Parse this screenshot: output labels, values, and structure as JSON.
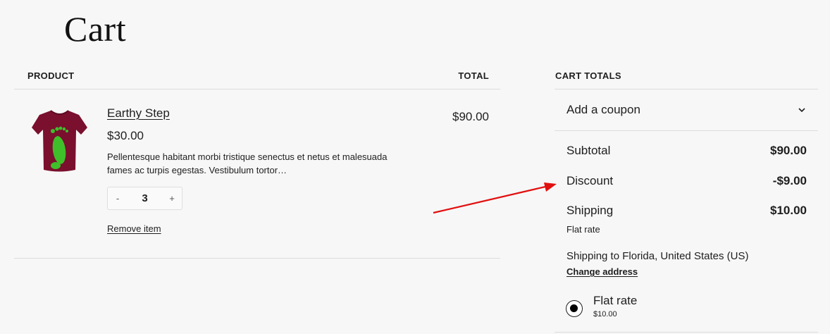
{
  "page": {
    "title": "Cart"
  },
  "table": {
    "product_header": "PRODUCT",
    "total_header": "TOTAL"
  },
  "item": {
    "name": "Earthy Step",
    "price": "$30.00",
    "description": "Pellentesque habitant morbi tristique senectus et netus et malesuada fames ac turpis egestas. Vestibulum tortor…",
    "quantity": "3",
    "decrease": "-",
    "increase": "+",
    "remove_label": "Remove item",
    "line_total": "$90.00",
    "image_icon": "tshirt-footprint-icon",
    "shirt_color": "#7a0f2e",
    "print_color": "#3fbf2a"
  },
  "totals": {
    "header": "CART TOTALS",
    "coupon_label": "Add a coupon",
    "subtotal_label": "Subtotal",
    "subtotal_value": "$90.00",
    "discount_label": "Discount",
    "discount_value": "-$9.00",
    "shipping_label": "Shipping",
    "shipping_value": "$10.00",
    "shipping_method": "Flat rate",
    "shipping_to": "Shipping to Florida, United States (US)",
    "change_address": "Change address",
    "rate_option_name": "Flat rate",
    "rate_option_price": "$10.00",
    "rate_selected": true
  },
  "annotation": {
    "arrow_color": "#e11010"
  }
}
